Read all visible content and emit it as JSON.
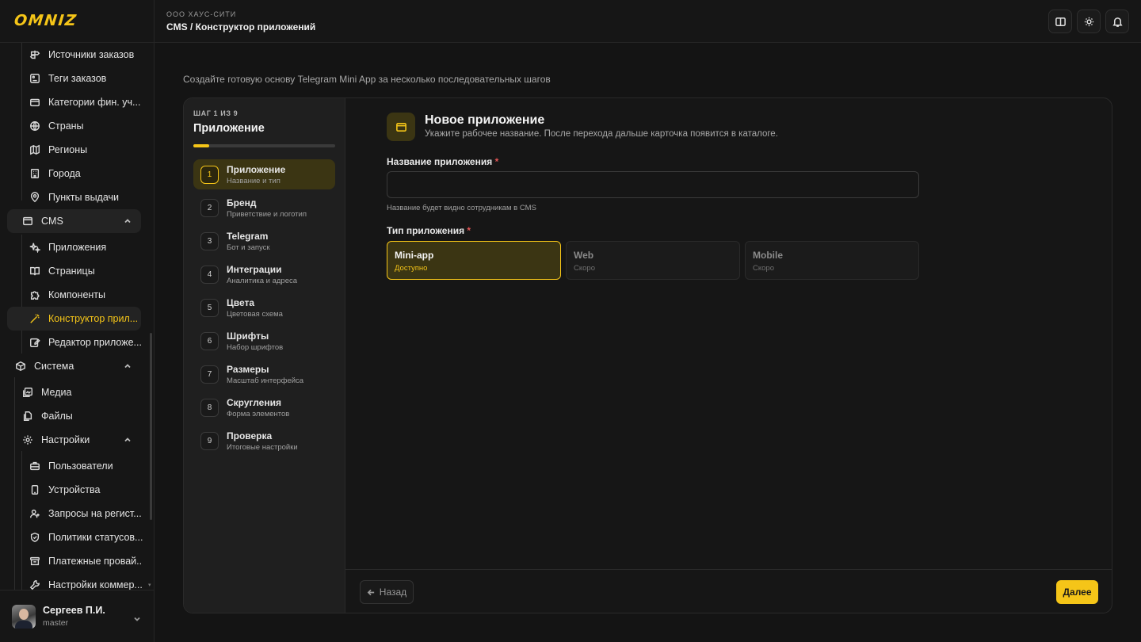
{
  "brand": {
    "logo": "OMNIZ",
    "accent": "#f5c518"
  },
  "header": {
    "org": "ООО ХАУС-СИТИ",
    "breadcrumb": "CMS / Конструктор приложений"
  },
  "sidebar": {
    "items": [
      {
        "label": "Источники заказов",
        "icon": "signpost-icon"
      },
      {
        "label": "Теги заказов",
        "icon": "tag-icon"
      },
      {
        "label": "Категории фин. уч...",
        "icon": "wallet-icon"
      },
      {
        "label": "Страны",
        "icon": "globe-icon"
      },
      {
        "label": "Регионы",
        "icon": "map-icon"
      },
      {
        "label": "Города",
        "icon": "building-icon"
      },
      {
        "label": "Пункты выдачи",
        "icon": "pin-icon"
      },
      {
        "label": "CMS",
        "icon": "window-icon"
      },
      {
        "label": "Приложения",
        "icon": "sparkle-icon"
      },
      {
        "label": "Страницы",
        "icon": "book-icon"
      },
      {
        "label": "Компоненты",
        "icon": "puzzle-icon"
      },
      {
        "label": "Конструктор прил...",
        "icon": "wand-icon"
      },
      {
        "label": "Редактор приложе...",
        "icon": "edit-icon"
      },
      {
        "label": "Система",
        "icon": "cube-icon"
      },
      {
        "label": "Медиа",
        "icon": "image-icon"
      },
      {
        "label": "Файлы",
        "icon": "files-icon"
      },
      {
        "label": "Настройки",
        "icon": "gear-icon"
      },
      {
        "label": "Пользователи",
        "icon": "briefcase-icon"
      },
      {
        "label": "Устройства",
        "icon": "phone-icon"
      },
      {
        "label": "Запросы на регист...",
        "icon": "user-plus-icon"
      },
      {
        "label": "Политики статусов...",
        "icon": "shield-icon"
      },
      {
        "label": "Платежные провай...",
        "icon": "archive-icon"
      },
      {
        "label": "Настройки коммер...",
        "icon": "wrench-icon"
      }
    ]
  },
  "user": {
    "name": "Сергеев П.И.",
    "role": "master"
  },
  "main": {
    "subtitle": "Создайте готовую основу Telegram Mini App за несколько последовательных шагов"
  },
  "wizard": {
    "counter": "ШАГ 1 ИЗ 9",
    "title": "Приложение",
    "progress": 0.111,
    "steps": [
      {
        "num": "1",
        "name": "Приложение",
        "desc": "Название и тип"
      },
      {
        "num": "2",
        "name": "Бренд",
        "desc": "Приветствие и логотип"
      },
      {
        "num": "3",
        "name": "Telegram",
        "desc": "Бот и запуск"
      },
      {
        "num": "4",
        "name": "Интеграции",
        "desc": "Аналитика и адреса"
      },
      {
        "num": "5",
        "name": "Цвета",
        "desc": "Цветовая схема"
      },
      {
        "num": "6",
        "name": "Шрифты",
        "desc": "Набор шрифтов"
      },
      {
        "num": "7",
        "name": "Размеры",
        "desc": "Масштаб интерфейса"
      },
      {
        "num": "8",
        "name": "Скругления",
        "desc": "Форма элементов"
      },
      {
        "num": "9",
        "name": "Проверка",
        "desc": "Итоговые настройки"
      }
    ]
  },
  "form": {
    "title": "Новое приложение",
    "subtitle": "Укажите рабочее название. После перехода дальше карточка появится в каталоге.",
    "name_label": "Название приложения",
    "name_value": "",
    "name_placeholder": "",
    "name_hint": "Название будет видно сотрудникам в CMS",
    "type_label": "Тип приложения",
    "required_mark": "*",
    "types": [
      {
        "name": "Mini-app",
        "status": "Доступно"
      },
      {
        "name": "Web",
        "status": "Скоро"
      },
      {
        "name": "Mobile",
        "status": "Скоро"
      }
    ]
  },
  "footer": {
    "back_label": "Назад",
    "next_label": "Далее"
  }
}
